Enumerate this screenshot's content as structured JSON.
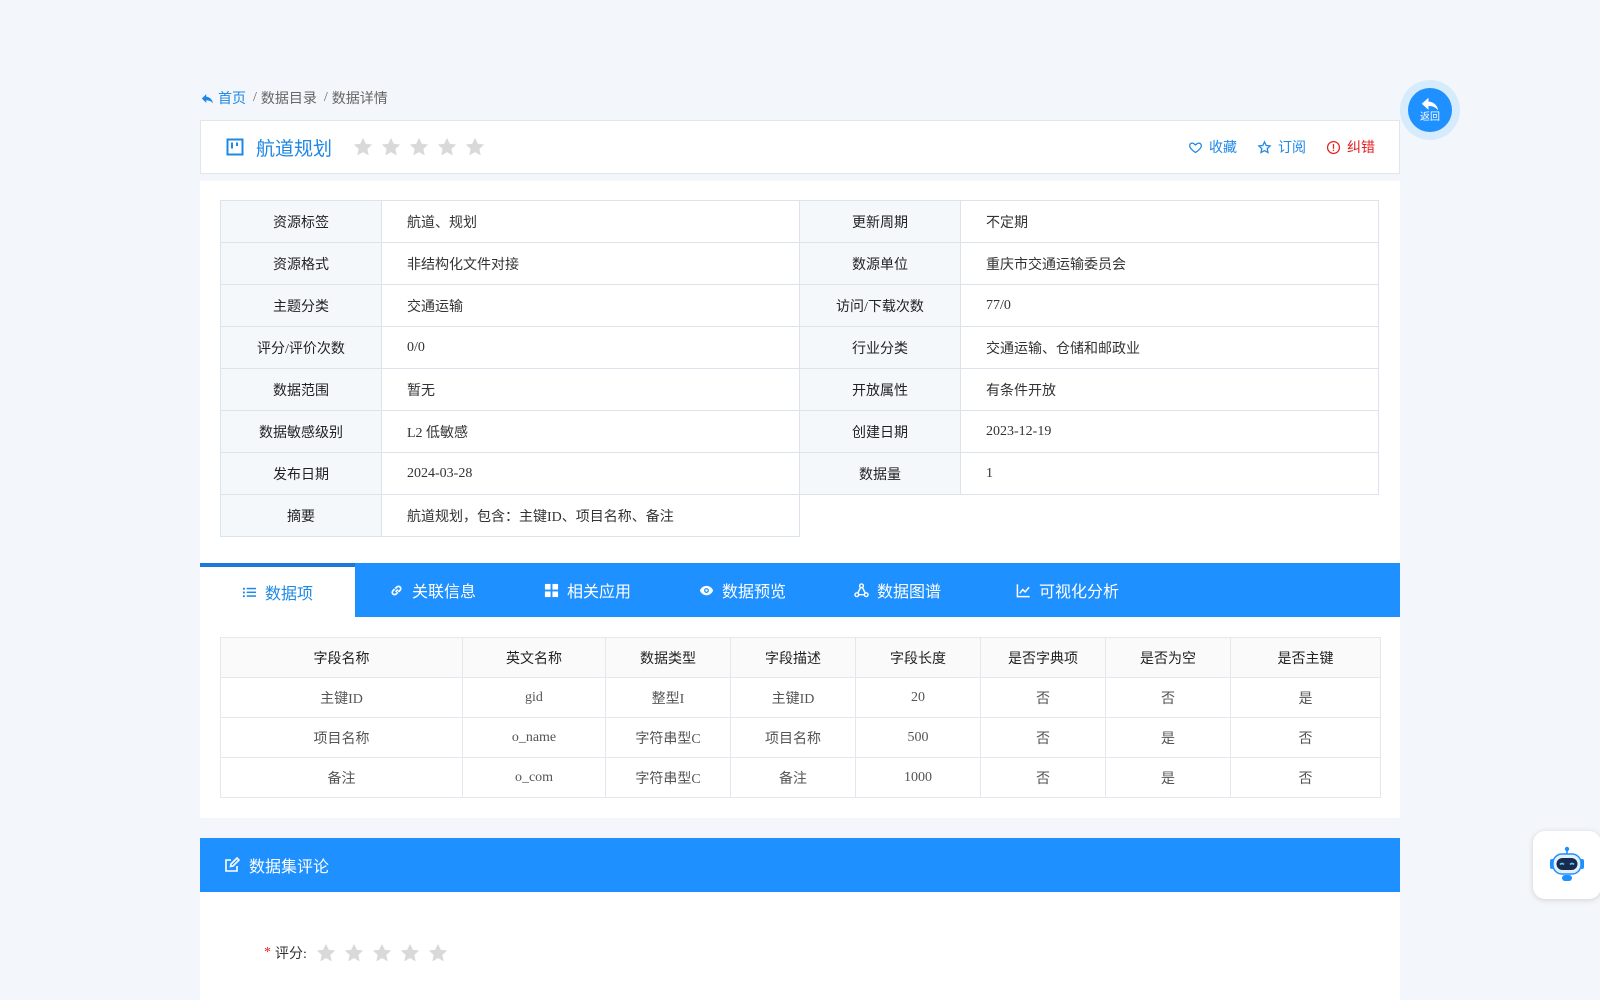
{
  "breadcrumb": {
    "home": "首页",
    "items": [
      "数据目录",
      "数据详情"
    ],
    "separator": "/"
  },
  "header": {
    "title": "航道规划",
    "rating_stars": 0,
    "actions": {
      "favorite": "收藏",
      "subscribe": "订阅",
      "report_error": "纠错"
    }
  },
  "info": {
    "rows": [
      [
        {
          "k": "资源标签",
          "v": "航道、规划"
        },
        {
          "k": "更新周期",
          "v": "不定期"
        }
      ],
      [
        {
          "k": "资源格式",
          "v": "非结构化文件对接"
        },
        {
          "k": "数源单位",
          "v": "重庆市交通运输委员会"
        }
      ],
      [
        {
          "k": "主题分类",
          "v": "交通运输"
        },
        {
          "k": "访问/下载次数",
          "v": "77/0"
        }
      ],
      [
        {
          "k": "评分/评价次数",
          "v": "0/0"
        },
        {
          "k": "行业分类",
          "v": "交通运输、仓储和邮政业"
        }
      ],
      [
        {
          "k": "数据范围",
          "v": "暂无"
        },
        {
          "k": "开放属性",
          "v": "有条件开放"
        }
      ],
      [
        {
          "k": "数据敏感级别",
          "v": "L2 低敏感"
        },
        {
          "k": "创建日期",
          "v": "2023-12-19"
        }
      ],
      [
        {
          "k": "发布日期",
          "v": "2024-03-28"
        },
        {
          "k": "数据量",
          "v": "1"
        }
      ],
      [
        {
          "k": "摘要",
          "v": "航道规划，包含：主键ID、项目名称、备注"
        }
      ]
    ]
  },
  "tabs": [
    {
      "label": "数据项",
      "icon": "list-icon",
      "active": true
    },
    {
      "label": "关联信息",
      "icon": "link-icon",
      "active": false
    },
    {
      "label": "相关应用",
      "icon": "grid-icon",
      "active": false
    },
    {
      "label": "数据预览",
      "icon": "eye-icon",
      "active": false
    },
    {
      "label": "数据图谱",
      "icon": "graph-icon",
      "active": false
    },
    {
      "label": "可视化分析",
      "icon": "chart-icon",
      "active": false
    }
  ],
  "fields": {
    "columns": [
      "字段名称",
      "英文名称",
      "数据类型",
      "字段描述",
      "字段长度",
      "是否字典项",
      "是否为空",
      "是否主键"
    ],
    "rows": [
      [
        "主键ID",
        "gid",
        "整型I",
        "主键ID",
        "20",
        "否",
        "否",
        "是"
      ],
      [
        "项目名称",
        "o_name",
        "字符串型C",
        "项目名称",
        "500",
        "否",
        "是",
        "否"
      ],
      [
        "备注",
        "o_com",
        "字符串型C",
        "备注",
        "1000",
        "否",
        "是",
        "否"
      ]
    ]
  },
  "comment": {
    "title": "数据集评论",
    "required_mark": "*",
    "rating_label": "评分:",
    "rating_stars": 0
  },
  "floating": {
    "back_label": "返回",
    "assistant_icon": "robot-icon"
  },
  "colors": {
    "accent": "#1e90ff",
    "link": "#1e88e5",
    "error": "#e02020",
    "star_empty": "#d9d9d9"
  }
}
